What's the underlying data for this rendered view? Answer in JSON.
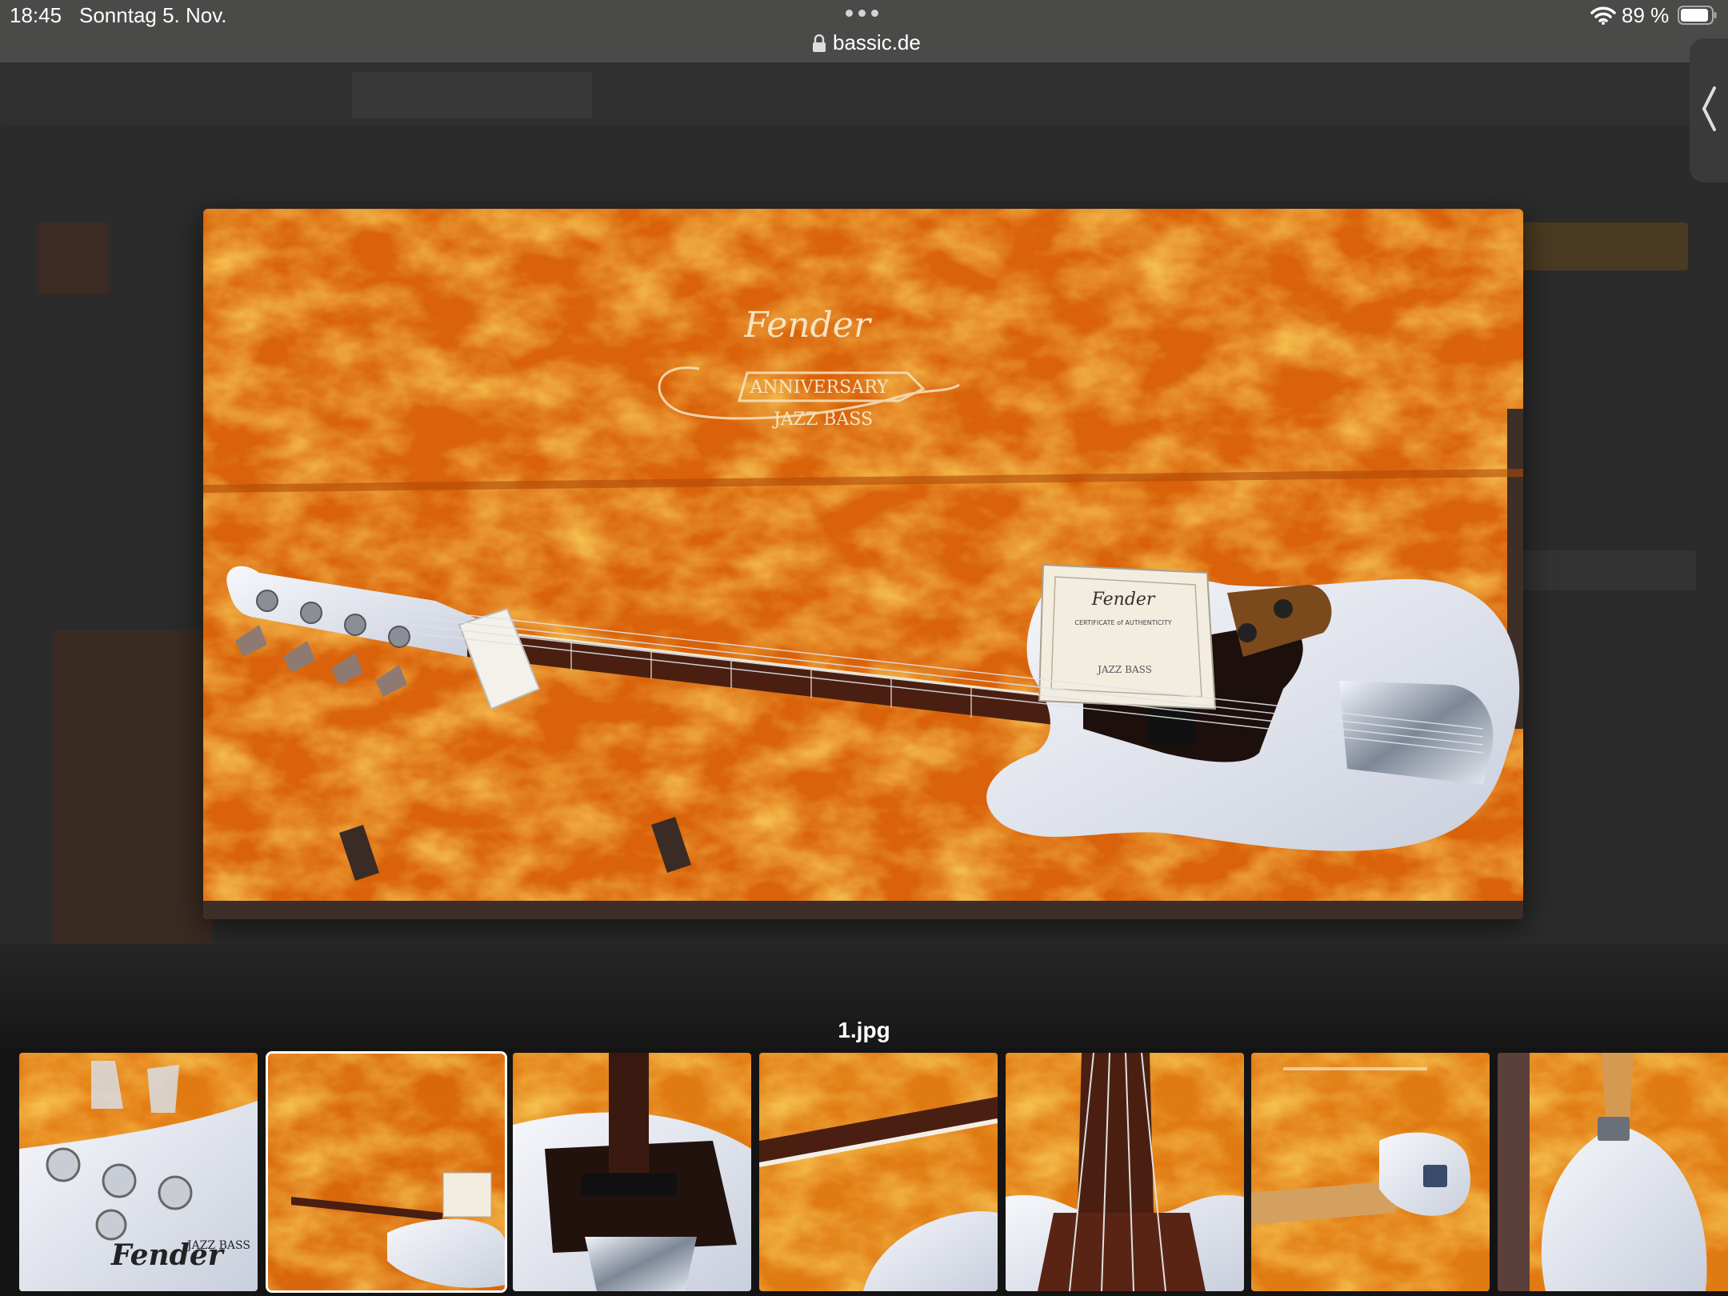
{
  "status_bar": {
    "time": "18:45",
    "date": "Sonntag 5. Nov.",
    "url": "bassic.de",
    "battery": "89 %"
  },
  "viewer": {
    "caption": "1.jpg",
    "selected_index": 1,
    "thumbnails": [
      {
        "name": "thumb-headstock"
      },
      {
        "name": "thumb-case-overview"
      },
      {
        "name": "thumb-body-closeup"
      },
      {
        "name": "thumb-neck-detail"
      },
      {
        "name": "thumb-fretboard"
      },
      {
        "name": "thumb-case-back"
      },
      {
        "name": "thumb-body-back"
      }
    ]
  },
  "main_image": {
    "logo_script": "Fender",
    "logo_banner": "ANNIVERSARY",
    "logo_model": "JAZZ BASS",
    "certificate_title": "Fender",
    "certificate_subtitle": "CERTIFICATE of AUTHENTICITY",
    "certificate_model": "JAZZ BASS"
  },
  "thumb_labels": {
    "headstock_brand": "Fender",
    "headstock_model": "JAZZ BASS"
  },
  "colors": {
    "velvet": "#e0780f",
    "velvet_light": "#f5b230",
    "body_white": "#e9ecf2",
    "status_bar": "#4a4a48"
  }
}
